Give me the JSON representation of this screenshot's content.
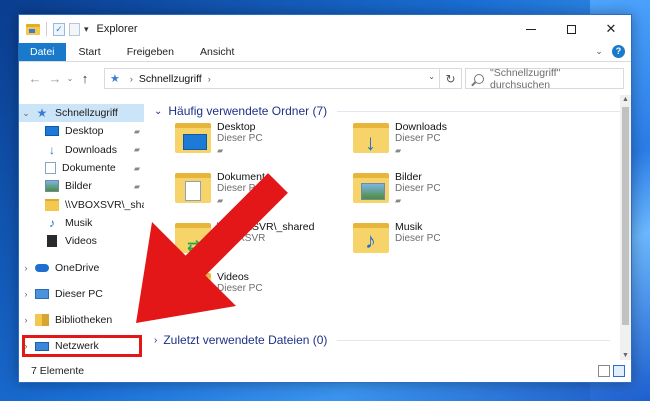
{
  "window": {
    "title": "Explorer",
    "close_glyph": "✕",
    "minimize_glyph": "",
    "maximize_glyph": ""
  },
  "ribbon": {
    "tabs": [
      "Datei",
      "Start",
      "Freigeben",
      "Ansicht"
    ],
    "collapse_glyph": "⌄",
    "help_glyph": "?"
  },
  "toolbar": {
    "back_glyph": "←",
    "forward_glyph": "→",
    "recent_glyph": "⌄",
    "up_glyph": "↑",
    "refresh_glyph": "↻"
  },
  "address": {
    "star_glyph": "★",
    "sep_glyph": "›",
    "path": "Schnellzugriff",
    "path_sep_glyph": "›",
    "drop_glyph": "⌄"
  },
  "search": {
    "placeholder": "\"Schnellzugriff\" durchsuchen"
  },
  "nav": {
    "quick_access": "Schnellzugriff",
    "items": [
      {
        "label": "Desktop",
        "icon": "desktop-icon",
        "pinned": true
      },
      {
        "label": "Downloads",
        "icon": "download-icon",
        "pinned": true
      },
      {
        "label": "Dokumente",
        "icon": "documents-icon",
        "pinned": true
      },
      {
        "label": "Bilder",
        "icon": "pictures-icon",
        "pinned": true
      },
      {
        "label": "\\\\VBOXSVR\\_sharec",
        "icon": "network-folder-icon",
        "pinned": false
      },
      {
        "label": "Musik",
        "icon": "music-icon",
        "pinned": false
      },
      {
        "label": "Videos",
        "icon": "videos-icon",
        "pinned": false
      }
    ],
    "onedrive": "OneDrive",
    "this_pc": "Dieser PC",
    "libraries": "Bibliotheken",
    "network": "Netzwerk",
    "pin_glyph": "📌",
    "expand_glyph": "›",
    "collapse_glyph": "⌄"
  },
  "content": {
    "frequent_header": "Häufig verwendete Ordner (7)",
    "recent_header": "Zuletzt verwendete Dateien (0)",
    "group_open_glyph": "⌄",
    "group_closed_glyph": "›",
    "folders": [
      {
        "name": "Desktop",
        "location": "Dieser PC",
        "pinned": true,
        "icon": "desktop-folder-icon"
      },
      {
        "name": "Downloads",
        "location": "Dieser PC",
        "pinned": true,
        "icon": "downloads-folder-icon"
      },
      {
        "name": "Dokumente",
        "location": "Dieser PC",
        "pinned": true,
        "icon": "documents-folder-icon"
      },
      {
        "name": "Bilder",
        "location": "Dieser PC",
        "pinned": true,
        "icon": "pictures-folder-icon"
      },
      {
        "name": "\\\\VBOXSVR\\_shared",
        "location": "VBOXSVR",
        "pinned": false,
        "icon": "network-share-folder-icon"
      },
      {
        "name": "Musik",
        "location": "Dieser PC",
        "pinned": false,
        "icon": "music-folder-icon"
      },
      {
        "name": "Videos",
        "location": "Dieser PC",
        "pinned": false,
        "icon": "videos-folder-icon"
      }
    ]
  },
  "status": {
    "count": "7 Elemente"
  },
  "colors": {
    "accent": "#1979ca",
    "highlight": "#e31717",
    "selection": "#cce4f7",
    "group_header": "#1e3287"
  }
}
